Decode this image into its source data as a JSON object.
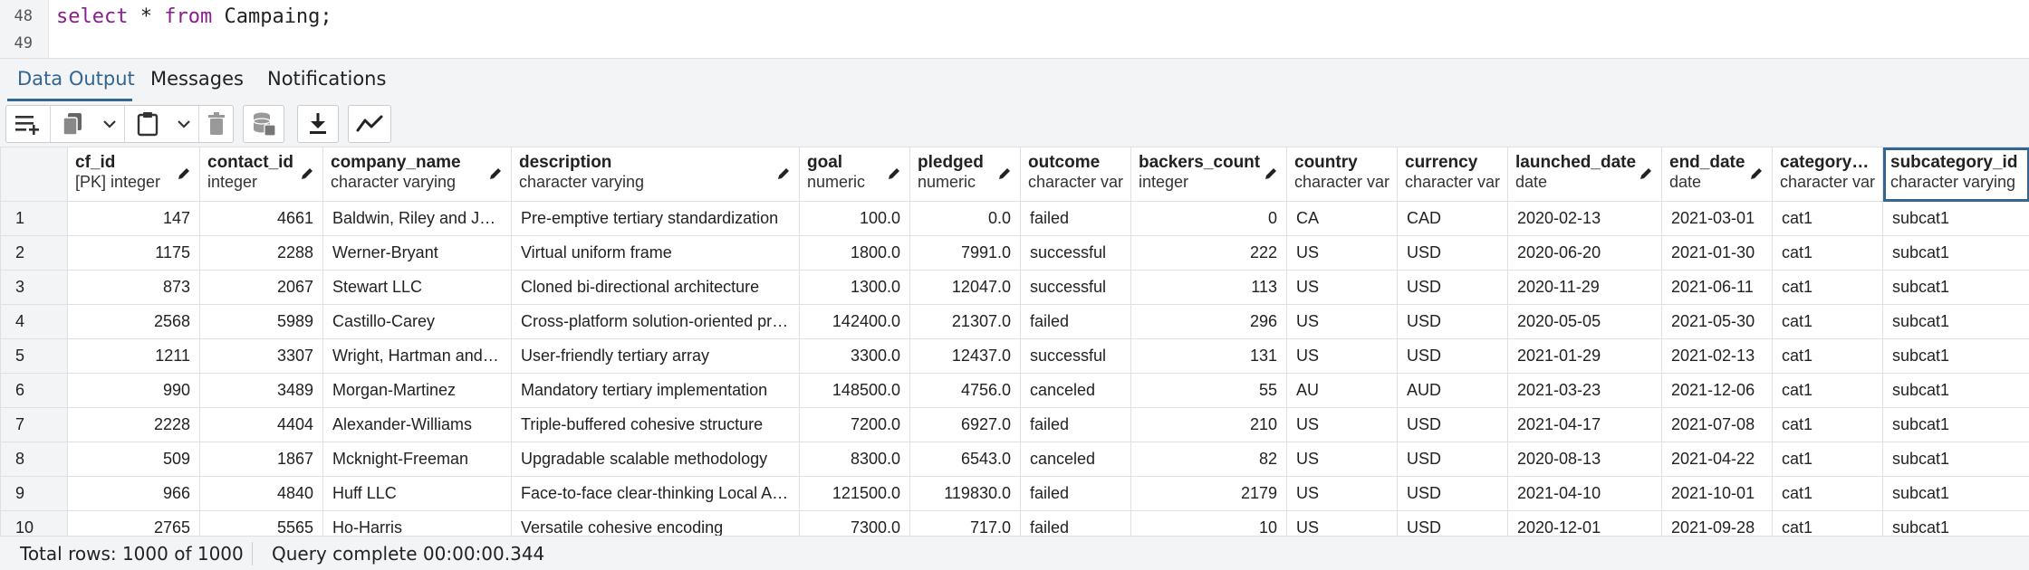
{
  "editor": {
    "lines": [
      {
        "number": "48",
        "keyword1": "select",
        "mid": " * ",
        "keyword2": "from",
        "rest": " Campaing;"
      },
      {
        "number": "49"
      }
    ]
  },
  "tabs": [
    {
      "label": "Data Output",
      "active": true
    },
    {
      "label": "Messages",
      "active": false
    },
    {
      "label": "Notifications",
      "active": false
    }
  ],
  "toolbar": {
    "buttons": [
      "add-row-icon",
      "copy-icon",
      "chevron-down-icon",
      "paste-icon",
      "chevron-down-icon",
      "delete-icon",
      "save-data-icon",
      "download-icon",
      "graph-icon"
    ]
  },
  "grid": {
    "columns": [
      {
        "name": "cf_id",
        "type": "[PK] integer"
      },
      {
        "name": "contact_id",
        "type": "integer"
      },
      {
        "name": "company_name",
        "type": "character varying"
      },
      {
        "name": "description",
        "type": "character varying"
      },
      {
        "name": "goal",
        "type": "numeric"
      },
      {
        "name": "pledged",
        "type": "numeric"
      },
      {
        "name": "outcome",
        "type": "character varying"
      },
      {
        "name": "backers_count",
        "type": "integer"
      },
      {
        "name": "country",
        "type": "character varying"
      },
      {
        "name": "currency",
        "type": "character varying"
      },
      {
        "name": "launched_date",
        "type": "date"
      },
      {
        "name": "end_date",
        "type": "date"
      },
      {
        "name": "category_id",
        "type": "character varying"
      },
      {
        "name": "subcategory_id",
        "type": "character varying"
      }
    ],
    "rows": [
      {
        "n": "1",
        "cells": [
          "147",
          "4661",
          "Baldwin, Riley and Jackson",
          "Pre-emptive tertiary standardization",
          "100.0",
          "0.0",
          "failed",
          "0",
          "CA",
          "CAD",
          "2020-02-13",
          "2021-03-01",
          "cat1",
          "subcat1"
        ]
      },
      {
        "n": "2",
        "cells": [
          "1175",
          "2288",
          "Werner-Bryant",
          "Virtual uniform frame",
          "1800.0",
          "7991.0",
          "successful",
          "222",
          "US",
          "USD",
          "2020-06-20",
          "2021-01-30",
          "cat1",
          "subcat1"
        ]
      },
      {
        "n": "3",
        "cells": [
          "873",
          "2067",
          "Stewart LLC",
          "Cloned bi-directional architecture",
          "1300.0",
          "12047.0",
          "successful",
          "113",
          "US",
          "USD",
          "2020-11-29",
          "2021-06-11",
          "cat1",
          "subcat1"
        ]
      },
      {
        "n": "4",
        "cells": [
          "2568",
          "5989",
          "Castillo-Carey",
          "Cross-platform solution-oriented process improvement",
          "142400.0",
          "21307.0",
          "failed",
          "296",
          "US",
          "USD",
          "2020-05-05",
          "2021-05-30",
          "cat1",
          "subcat1"
        ]
      },
      {
        "n": "5",
        "cells": [
          "1211",
          "3307",
          "Wright, Hartman and Yu",
          "User-friendly tertiary array",
          "3300.0",
          "12437.0",
          "successful",
          "131",
          "US",
          "USD",
          "2021-01-29",
          "2021-02-13",
          "cat1",
          "subcat1"
        ]
      },
      {
        "n": "6",
        "cells": [
          "990",
          "3489",
          "Morgan-Martinez",
          "Mandatory tertiary implementation",
          "148500.0",
          "4756.0",
          "canceled",
          "55",
          "AU",
          "AUD",
          "2021-03-23",
          "2021-12-06",
          "cat1",
          "subcat1"
        ]
      },
      {
        "n": "7",
        "cells": [
          "2228",
          "4404",
          "Alexander-Williams",
          "Triple-buffered cohesive structure",
          "7200.0",
          "6927.0",
          "failed",
          "210",
          "US",
          "USD",
          "2021-04-17",
          "2021-07-08",
          "cat1",
          "subcat1"
        ]
      },
      {
        "n": "8",
        "cells": [
          "509",
          "1867",
          "Mcknight-Freeman",
          "Upgradable scalable methodology",
          "8300.0",
          "6543.0",
          "canceled",
          "82",
          "US",
          "USD",
          "2020-08-13",
          "2021-04-22",
          "cat1",
          "subcat1"
        ]
      },
      {
        "n": "9",
        "cells": [
          "966",
          "4840",
          "Huff LLC",
          "Face-to-face clear-thinking Local Area Network",
          "121500.0",
          "119830.0",
          "failed",
          "2179",
          "US",
          "USD",
          "2021-04-10",
          "2021-10-01",
          "cat1",
          "subcat1"
        ]
      },
      {
        "n": "10",
        "cells": [
          "2765",
          "5565",
          "Ho-Harris",
          "Versatile cohesive encoding",
          "7300.0",
          "717.0",
          "failed",
          "10",
          "US",
          "USD",
          "2020-12-01",
          "2021-09-28",
          "cat1",
          "subcat1"
        ]
      }
    ]
  },
  "status": {
    "total_rows": "Total rows: 1000 of 1000",
    "query_status": "Query complete 00:00:00.344"
  }
}
